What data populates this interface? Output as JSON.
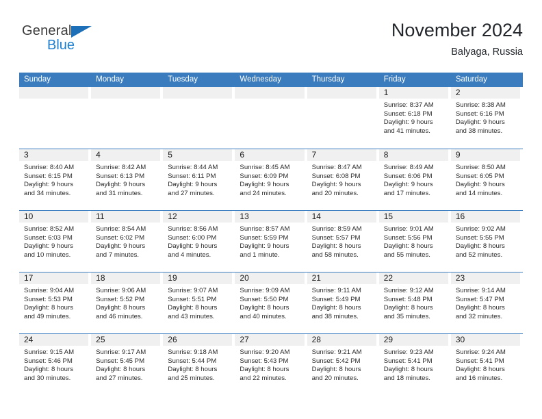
{
  "brand": {
    "name_top": "General",
    "name_bottom": "Blue",
    "triangle_color": "#1d6fb8",
    "blue_color": "#1d7fd0"
  },
  "header": {
    "title": "November 2024",
    "subtitle": "Balyaga, Russia"
  },
  "theme": {
    "header_bar_color": "#3a7cbe",
    "day_number_band_color": "#f0f0f0",
    "row_divider_color": "#3a7cbe",
    "text_color": "#2a2a2a"
  },
  "weekdays": [
    "Sunday",
    "Monday",
    "Tuesday",
    "Wednesday",
    "Thursday",
    "Friday",
    "Saturday"
  ],
  "weeks": [
    [
      {
        "day": "",
        "empty": true,
        "sunrise": "",
        "sunset": "",
        "daylight_line1": "",
        "daylight_line2": ""
      },
      {
        "day": "",
        "empty": true,
        "sunrise": "",
        "sunset": "",
        "daylight_line1": "",
        "daylight_line2": ""
      },
      {
        "day": "",
        "empty": true,
        "sunrise": "",
        "sunset": "",
        "daylight_line1": "",
        "daylight_line2": ""
      },
      {
        "day": "",
        "empty": true,
        "sunrise": "",
        "sunset": "",
        "daylight_line1": "",
        "daylight_line2": ""
      },
      {
        "day": "",
        "empty": true,
        "sunrise": "",
        "sunset": "",
        "daylight_line1": "",
        "daylight_line2": ""
      },
      {
        "day": "1",
        "empty": false,
        "sunrise": "Sunrise: 8:37 AM",
        "sunset": "Sunset: 6:18 PM",
        "daylight_line1": "Daylight: 9 hours",
        "daylight_line2": "and 41 minutes."
      },
      {
        "day": "2",
        "empty": false,
        "sunrise": "Sunrise: 8:38 AM",
        "sunset": "Sunset: 6:16 PM",
        "daylight_line1": "Daylight: 9 hours",
        "daylight_line2": "and 38 minutes."
      }
    ],
    [
      {
        "day": "3",
        "empty": false,
        "sunrise": "Sunrise: 8:40 AM",
        "sunset": "Sunset: 6:15 PM",
        "daylight_line1": "Daylight: 9 hours",
        "daylight_line2": "and 34 minutes."
      },
      {
        "day": "4",
        "empty": false,
        "sunrise": "Sunrise: 8:42 AM",
        "sunset": "Sunset: 6:13 PM",
        "daylight_line1": "Daylight: 9 hours",
        "daylight_line2": "and 31 minutes."
      },
      {
        "day": "5",
        "empty": false,
        "sunrise": "Sunrise: 8:44 AM",
        "sunset": "Sunset: 6:11 PM",
        "daylight_line1": "Daylight: 9 hours",
        "daylight_line2": "and 27 minutes."
      },
      {
        "day": "6",
        "empty": false,
        "sunrise": "Sunrise: 8:45 AM",
        "sunset": "Sunset: 6:09 PM",
        "daylight_line1": "Daylight: 9 hours",
        "daylight_line2": "and 24 minutes."
      },
      {
        "day": "7",
        "empty": false,
        "sunrise": "Sunrise: 8:47 AM",
        "sunset": "Sunset: 6:08 PM",
        "daylight_line1": "Daylight: 9 hours",
        "daylight_line2": "and 20 minutes."
      },
      {
        "day": "8",
        "empty": false,
        "sunrise": "Sunrise: 8:49 AM",
        "sunset": "Sunset: 6:06 PM",
        "daylight_line1": "Daylight: 9 hours",
        "daylight_line2": "and 17 minutes."
      },
      {
        "day": "9",
        "empty": false,
        "sunrise": "Sunrise: 8:50 AM",
        "sunset": "Sunset: 6:05 PM",
        "daylight_line1": "Daylight: 9 hours",
        "daylight_line2": "and 14 minutes."
      }
    ],
    [
      {
        "day": "10",
        "empty": false,
        "sunrise": "Sunrise: 8:52 AM",
        "sunset": "Sunset: 6:03 PM",
        "daylight_line1": "Daylight: 9 hours",
        "daylight_line2": "and 10 minutes."
      },
      {
        "day": "11",
        "empty": false,
        "sunrise": "Sunrise: 8:54 AM",
        "sunset": "Sunset: 6:02 PM",
        "daylight_line1": "Daylight: 9 hours",
        "daylight_line2": "and 7 minutes."
      },
      {
        "day": "12",
        "empty": false,
        "sunrise": "Sunrise: 8:56 AM",
        "sunset": "Sunset: 6:00 PM",
        "daylight_line1": "Daylight: 9 hours",
        "daylight_line2": "and 4 minutes."
      },
      {
        "day": "13",
        "empty": false,
        "sunrise": "Sunrise: 8:57 AM",
        "sunset": "Sunset: 5:59 PM",
        "daylight_line1": "Daylight: 9 hours",
        "daylight_line2": "and 1 minute."
      },
      {
        "day": "14",
        "empty": false,
        "sunrise": "Sunrise: 8:59 AM",
        "sunset": "Sunset: 5:57 PM",
        "daylight_line1": "Daylight: 8 hours",
        "daylight_line2": "and 58 minutes."
      },
      {
        "day": "15",
        "empty": false,
        "sunrise": "Sunrise: 9:01 AM",
        "sunset": "Sunset: 5:56 PM",
        "daylight_line1": "Daylight: 8 hours",
        "daylight_line2": "and 55 minutes."
      },
      {
        "day": "16",
        "empty": false,
        "sunrise": "Sunrise: 9:02 AM",
        "sunset": "Sunset: 5:55 PM",
        "daylight_line1": "Daylight: 8 hours",
        "daylight_line2": "and 52 minutes."
      }
    ],
    [
      {
        "day": "17",
        "empty": false,
        "sunrise": "Sunrise: 9:04 AM",
        "sunset": "Sunset: 5:53 PM",
        "daylight_line1": "Daylight: 8 hours",
        "daylight_line2": "and 49 minutes."
      },
      {
        "day": "18",
        "empty": false,
        "sunrise": "Sunrise: 9:06 AM",
        "sunset": "Sunset: 5:52 PM",
        "daylight_line1": "Daylight: 8 hours",
        "daylight_line2": "and 46 minutes."
      },
      {
        "day": "19",
        "empty": false,
        "sunrise": "Sunrise: 9:07 AM",
        "sunset": "Sunset: 5:51 PM",
        "daylight_line1": "Daylight: 8 hours",
        "daylight_line2": "and 43 minutes."
      },
      {
        "day": "20",
        "empty": false,
        "sunrise": "Sunrise: 9:09 AM",
        "sunset": "Sunset: 5:50 PM",
        "daylight_line1": "Daylight: 8 hours",
        "daylight_line2": "and 40 minutes."
      },
      {
        "day": "21",
        "empty": false,
        "sunrise": "Sunrise: 9:11 AM",
        "sunset": "Sunset: 5:49 PM",
        "daylight_line1": "Daylight: 8 hours",
        "daylight_line2": "and 38 minutes."
      },
      {
        "day": "22",
        "empty": false,
        "sunrise": "Sunrise: 9:12 AM",
        "sunset": "Sunset: 5:48 PM",
        "daylight_line1": "Daylight: 8 hours",
        "daylight_line2": "and 35 minutes."
      },
      {
        "day": "23",
        "empty": false,
        "sunrise": "Sunrise: 9:14 AM",
        "sunset": "Sunset: 5:47 PM",
        "daylight_line1": "Daylight: 8 hours",
        "daylight_line2": "and 32 minutes."
      }
    ],
    [
      {
        "day": "24",
        "empty": false,
        "sunrise": "Sunrise: 9:15 AM",
        "sunset": "Sunset: 5:46 PM",
        "daylight_line1": "Daylight: 8 hours",
        "daylight_line2": "and 30 minutes."
      },
      {
        "day": "25",
        "empty": false,
        "sunrise": "Sunrise: 9:17 AM",
        "sunset": "Sunset: 5:45 PM",
        "daylight_line1": "Daylight: 8 hours",
        "daylight_line2": "and 27 minutes."
      },
      {
        "day": "26",
        "empty": false,
        "sunrise": "Sunrise: 9:18 AM",
        "sunset": "Sunset: 5:44 PM",
        "daylight_line1": "Daylight: 8 hours",
        "daylight_line2": "and 25 minutes."
      },
      {
        "day": "27",
        "empty": false,
        "sunrise": "Sunrise: 9:20 AM",
        "sunset": "Sunset: 5:43 PM",
        "daylight_line1": "Daylight: 8 hours",
        "daylight_line2": "and 22 minutes."
      },
      {
        "day": "28",
        "empty": false,
        "sunrise": "Sunrise: 9:21 AM",
        "sunset": "Sunset: 5:42 PM",
        "daylight_line1": "Daylight: 8 hours",
        "daylight_line2": "and 20 minutes."
      },
      {
        "day": "29",
        "empty": false,
        "sunrise": "Sunrise: 9:23 AM",
        "sunset": "Sunset: 5:41 PM",
        "daylight_line1": "Daylight: 8 hours",
        "daylight_line2": "and 18 minutes."
      },
      {
        "day": "30",
        "empty": false,
        "sunrise": "Sunrise: 9:24 AM",
        "sunset": "Sunset: 5:41 PM",
        "daylight_line1": "Daylight: 8 hours",
        "daylight_line2": "and 16 minutes."
      }
    ]
  ]
}
